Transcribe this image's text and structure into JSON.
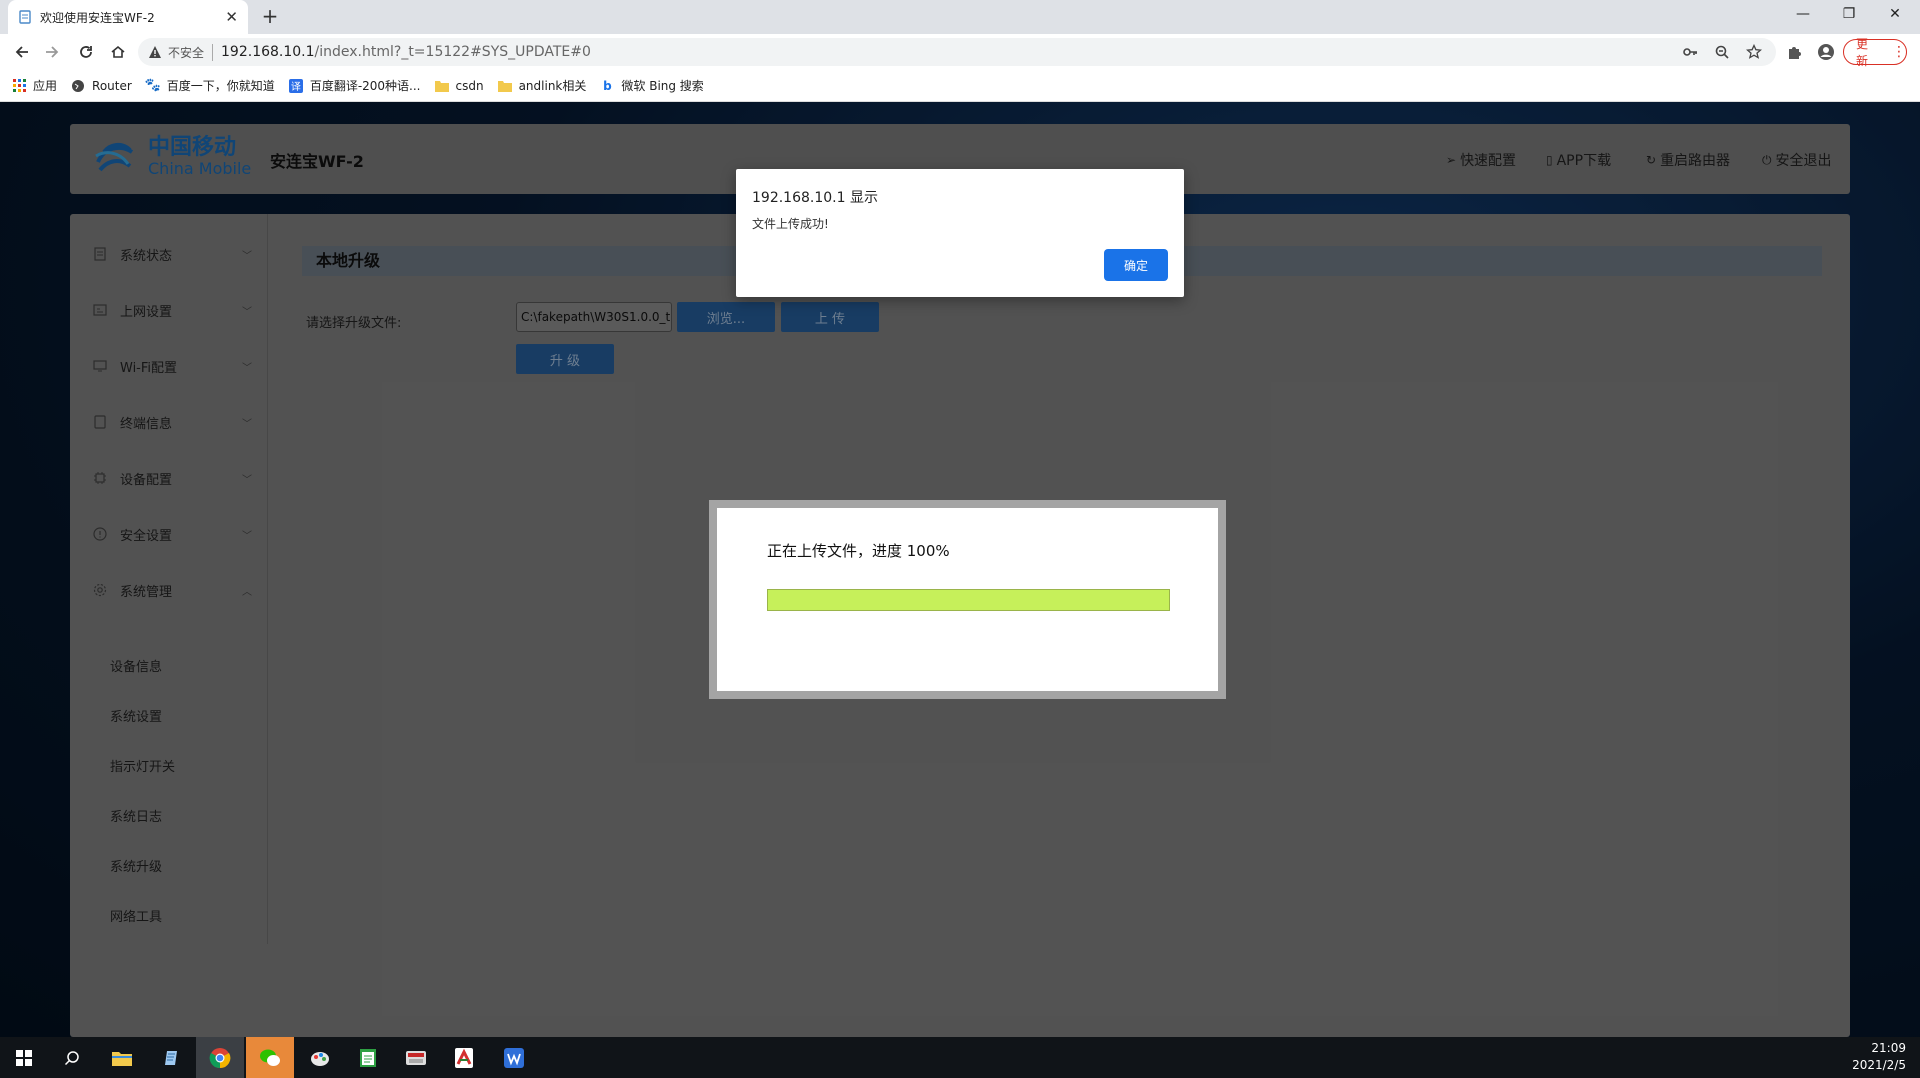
{
  "browser": {
    "tab_title": "欢迎使用安连宝WF-2",
    "url_warning": "不安全",
    "url_host": "192.168.10.1",
    "url_path": "/index.html?_t=15122#SYS_UPDATE#0",
    "update_label": "更新"
  },
  "bookmarks": [
    {
      "label": "应用",
      "icon": "apps-grid-icon"
    },
    {
      "label": "Router",
      "icon": "globe-icon"
    },
    {
      "label": "百度一下，你就知道",
      "icon": "baidu-paw-icon"
    },
    {
      "label": "百度翻译-200种语...",
      "icon": "translate-icon"
    },
    {
      "label": "csdn",
      "icon": "folder-icon"
    },
    {
      "label": "andlink相关",
      "icon": "folder-icon"
    },
    {
      "label": "微软 Bing 搜索",
      "icon": "bing-icon"
    }
  ],
  "header": {
    "logo_cn": "中国移动",
    "logo_en": "China Mobile",
    "product": "安连宝WF-2",
    "links": [
      "快速配置",
      "APP下载",
      "重启路由器",
      "安全退出"
    ]
  },
  "sidebar": {
    "menus": [
      "系统状态",
      "上网设置",
      "Wi-Fi配置",
      "终端信息",
      "设备配置",
      "安全设置",
      "系统管理"
    ],
    "submenu": [
      "设备信息",
      "系统设置",
      "指示灯开关",
      "系统日志",
      "系统升级",
      "网络工具"
    ]
  },
  "content": {
    "section_title": "本地升级",
    "file_label": "请选择升级文件:",
    "file_value": "C:\\fakepath\\W30S1.0.0_t",
    "browse_label": "浏览...",
    "upload_label": "上 传",
    "upgrade_label": "升 级"
  },
  "progress": {
    "text": "正在上传文件，进度 100%",
    "percent": 100
  },
  "alert": {
    "title": "192.168.10.1 显示",
    "message": "文件上传成功!",
    "ok_label": "确定"
  },
  "taskbar": {
    "time": "21:09",
    "date": "2021/2/5"
  },
  "colors": {
    "brand": "#1a6bb5",
    "button": "#255d98",
    "progress": "#c6f05a",
    "alert_ok": "#1a73e8",
    "update_red": "#d93025"
  }
}
